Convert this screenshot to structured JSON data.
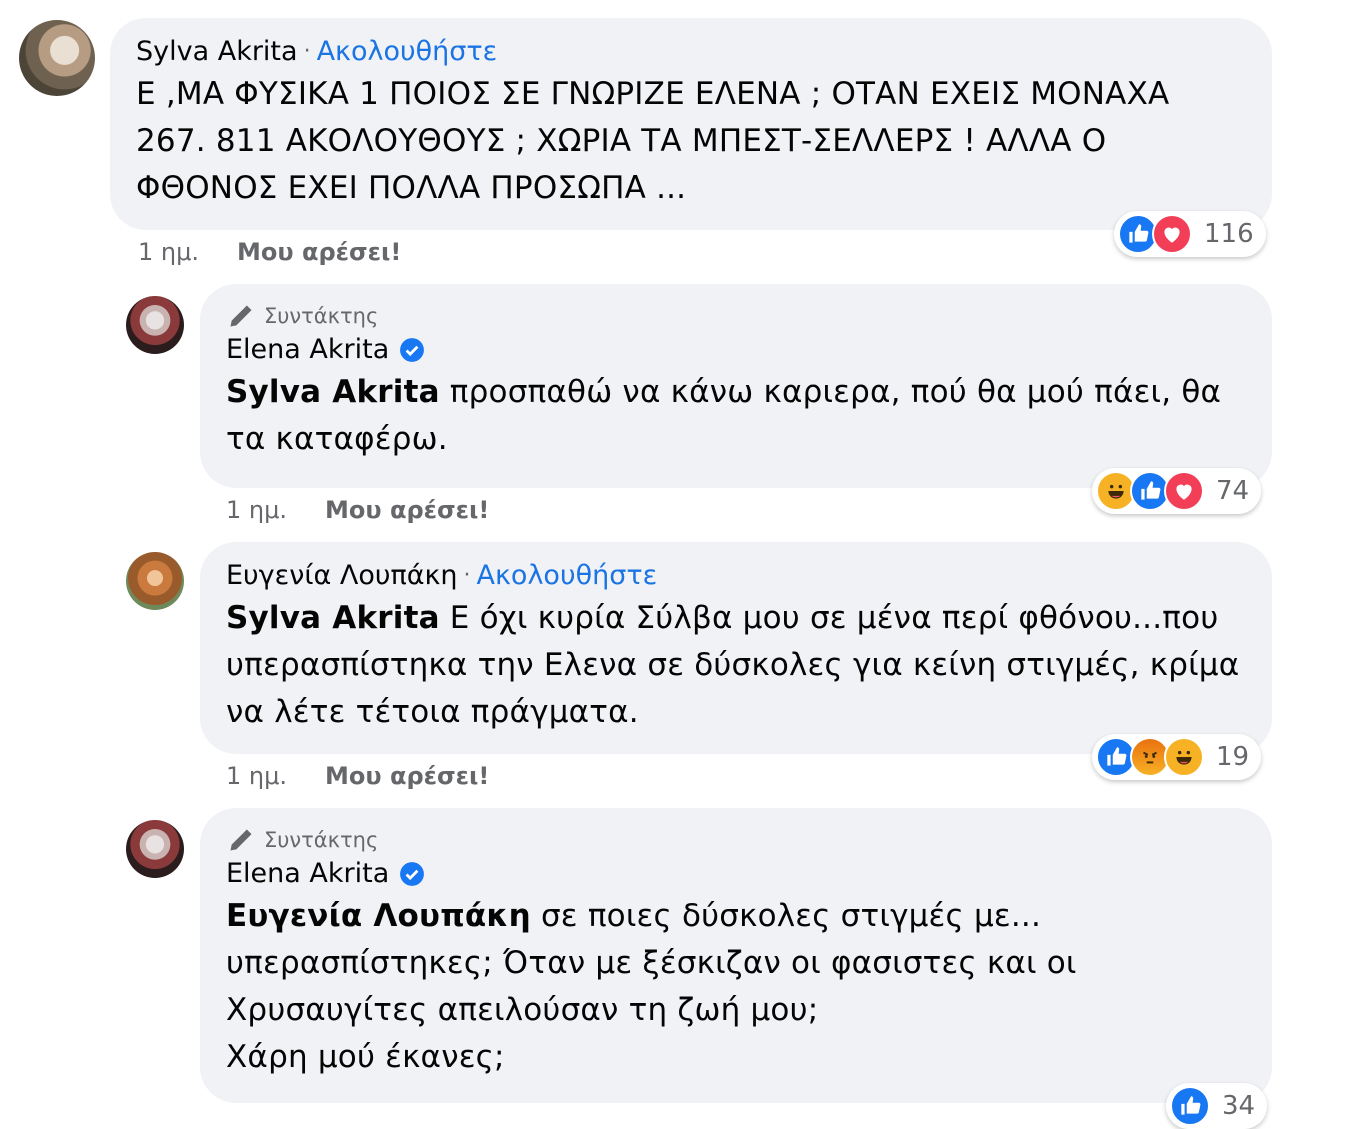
{
  "comments": [
    {
      "author": "Sylva Akrita",
      "dot": "·",
      "follow": "Ακολουθήστε",
      "text_lines": [
        "Ε ,ΜΑ ΦΥΣΙΚΑ 1 ΠΟΙΟΣ ΣΕ ΓΝΩΡΙΖΕ ΕΛΕΝΑ ; ΟΤΑΝ ΕΧΕΙΣ ΜΟΝΑΧΑ",
        "267. 811 ΑΚΟΛΟΥΘΟΥΣ ; ΧΩΡΙΑ ΤΑ ΜΠΕΣΤ-ΣΕΛΛΕΡΣ ! ΑΛΛΑ Ο",
        "ΦΘΟΝΟΣ ΕΧΕΙ ΠΟΛΛΑ ΠΡΟΣΩΠΑ ..."
      ],
      "time": "1 ημ.",
      "like": "Μου αρέσει!",
      "reactions": [
        "like",
        "love"
      ],
      "count": "116"
    },
    {
      "role": "Συντάκτης",
      "author": "Elena Akrita",
      "mention": "Sylva Akrita",
      "text_first": " προσπαθώ να κάνω καριερα, πού θα μού πάει, θα",
      "text_lines": [
        "τα καταφέρω."
      ],
      "time": "1 ημ.",
      "like": "Μου αρέσει!",
      "reactions": [
        "haha",
        "like",
        "love"
      ],
      "count": "74"
    },
    {
      "author": "Ευγενία Λουπάκη",
      "dot": "·",
      "follow": "Ακολουθήστε",
      "mention": "Sylva Akrita",
      "text_first": " Ε όχι κυρία Σύλβα μου σε μένα περί φθόνου...που",
      "text_lines": [
        "υπερασπίστηκα την Ελενα σε δύσκολες για κείνη στιγμές, κρίμα",
        "να λέτε τέτοια πράγματα."
      ],
      "time": "1 ημ.",
      "like": "Μου αρέσει!",
      "reactions": [
        "like",
        "angry",
        "haha"
      ],
      "count": "19"
    },
    {
      "role": "Συντάκτης",
      "author": "Elena Akrita",
      "mention": "Ευγενία Λουπάκη",
      "text_first": " σε ποιες δύσκολες στιγμές με...",
      "text_lines": [
        "υπερασπίστηκες; Όταν με ξέσκιζαν οι φασιστες και οι",
        "Χρυσαυγίτες απειλούσαν τη ζωή μου;",
        "Χάρη μού έκανες;"
      ],
      "reactions": [
        "like"
      ],
      "count": "34"
    }
  ],
  "colors": {
    "bubble": "#f0f2f5",
    "link": "#1b74e4",
    "secondary": "#65676b",
    "like": "#1877f2",
    "love": "#f33e58",
    "haha": "#f7b125"
  }
}
